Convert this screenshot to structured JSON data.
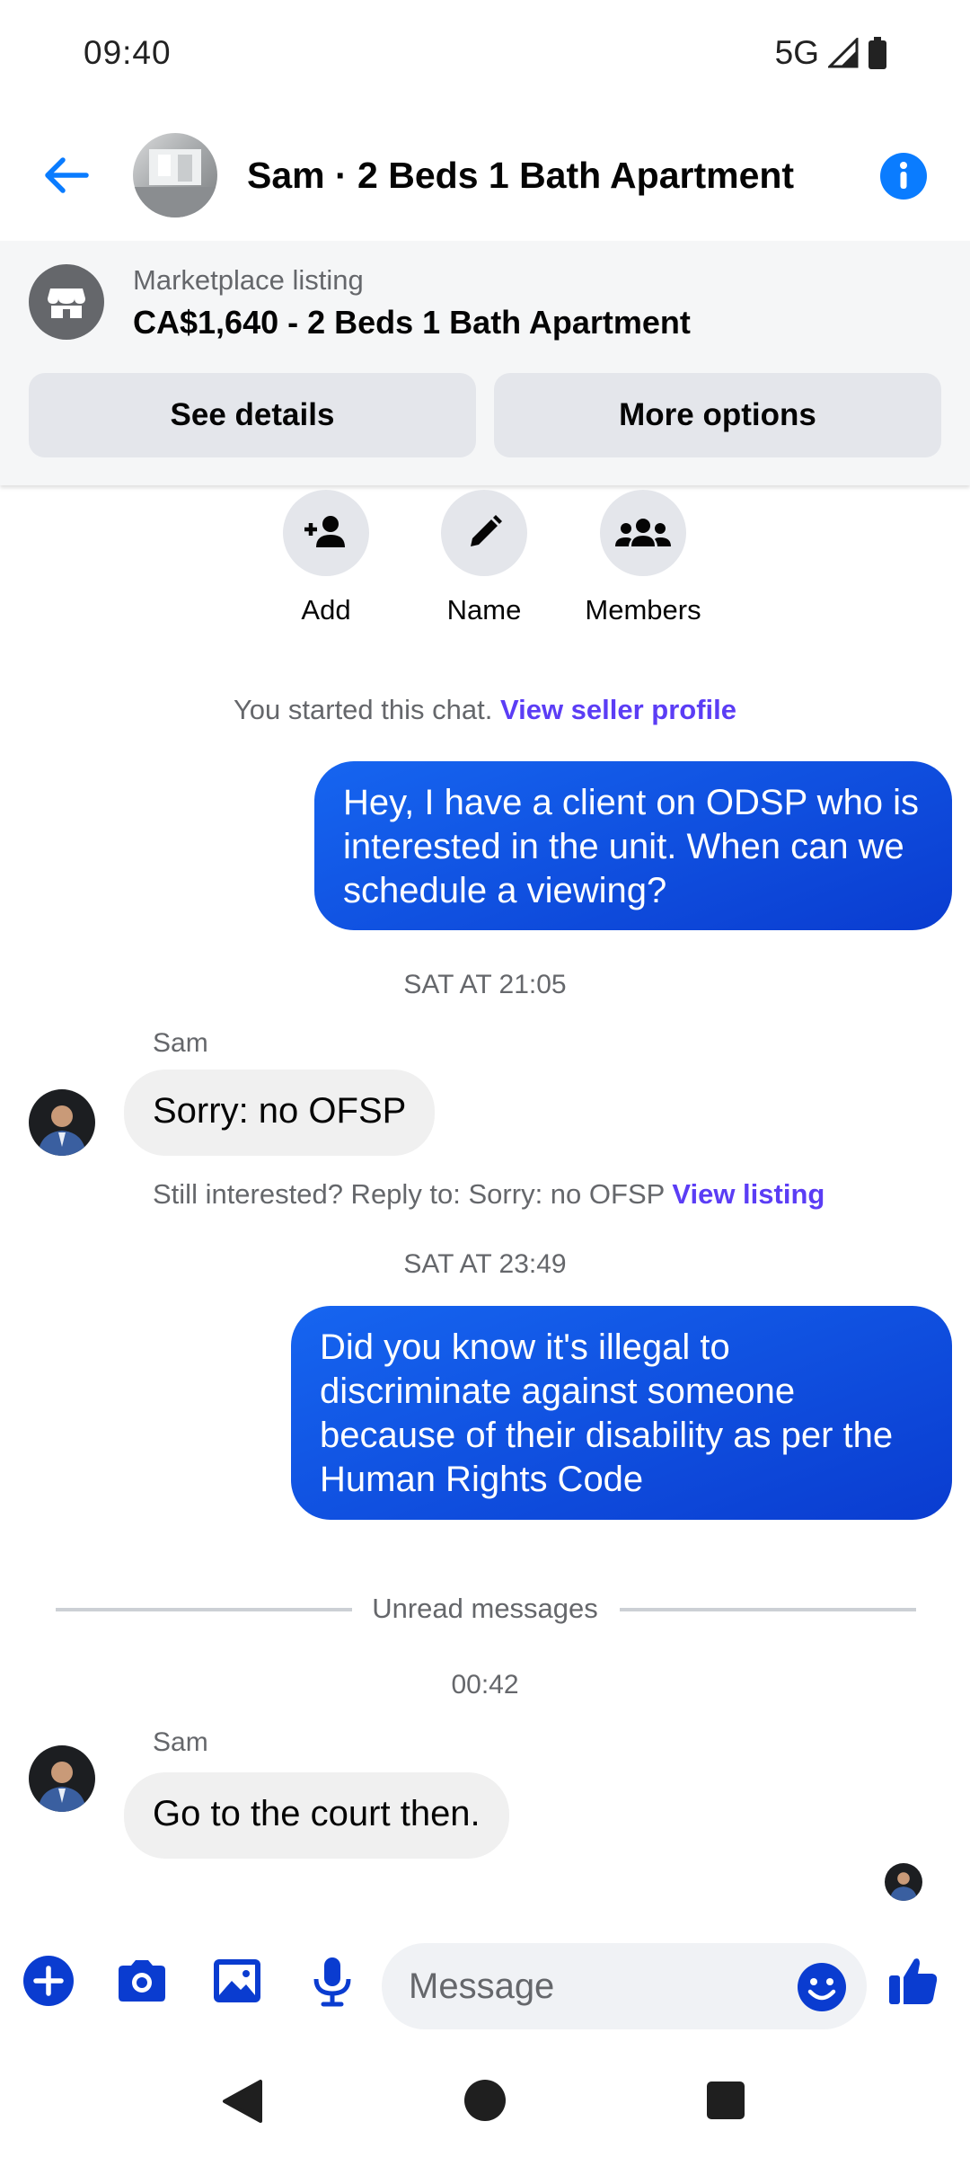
{
  "status_bar": {
    "time": "09:40",
    "network": "5G"
  },
  "header": {
    "title": "Sam · 2 Beds 1 Bath Apartment"
  },
  "listing": {
    "label": "Marketplace listing",
    "title": "CA$1,640 - 2 Beds 1 Bath Apartment",
    "see_details": "See details",
    "more_options": "More options"
  },
  "quick_actions": {
    "add": "Add",
    "name": "Name",
    "members": "Members"
  },
  "chat": {
    "started_text": "You started this chat.",
    "started_link": "View seller profile",
    "messages": [
      {
        "from": "me",
        "text": "Hey, I have a client on ODSP who is interested in the unit. When can we schedule a viewing?"
      },
      {
        "from": "Sam",
        "text": "Sorry: no OFSP"
      },
      {
        "from": "me",
        "text": "Did you know it's illegal to discriminate against someone because of their disability as per the Human Rights Code"
      },
      {
        "from": "Sam",
        "text": "Go to the court then."
      }
    ],
    "timestamps": [
      "SAT AT 21:05",
      "SAT AT 23:49",
      "00:42"
    ],
    "sender_name": "Sam",
    "reply_prompt": "Still interested? Reply to: Sorry: no OFSP",
    "reply_link": "View listing",
    "unread_label": "Unread messages"
  },
  "composer": {
    "placeholder": "Message"
  },
  "colors": {
    "accent": "#0a7cff",
    "link": "#5b3df5",
    "bubble_out": "#1665f0"
  }
}
